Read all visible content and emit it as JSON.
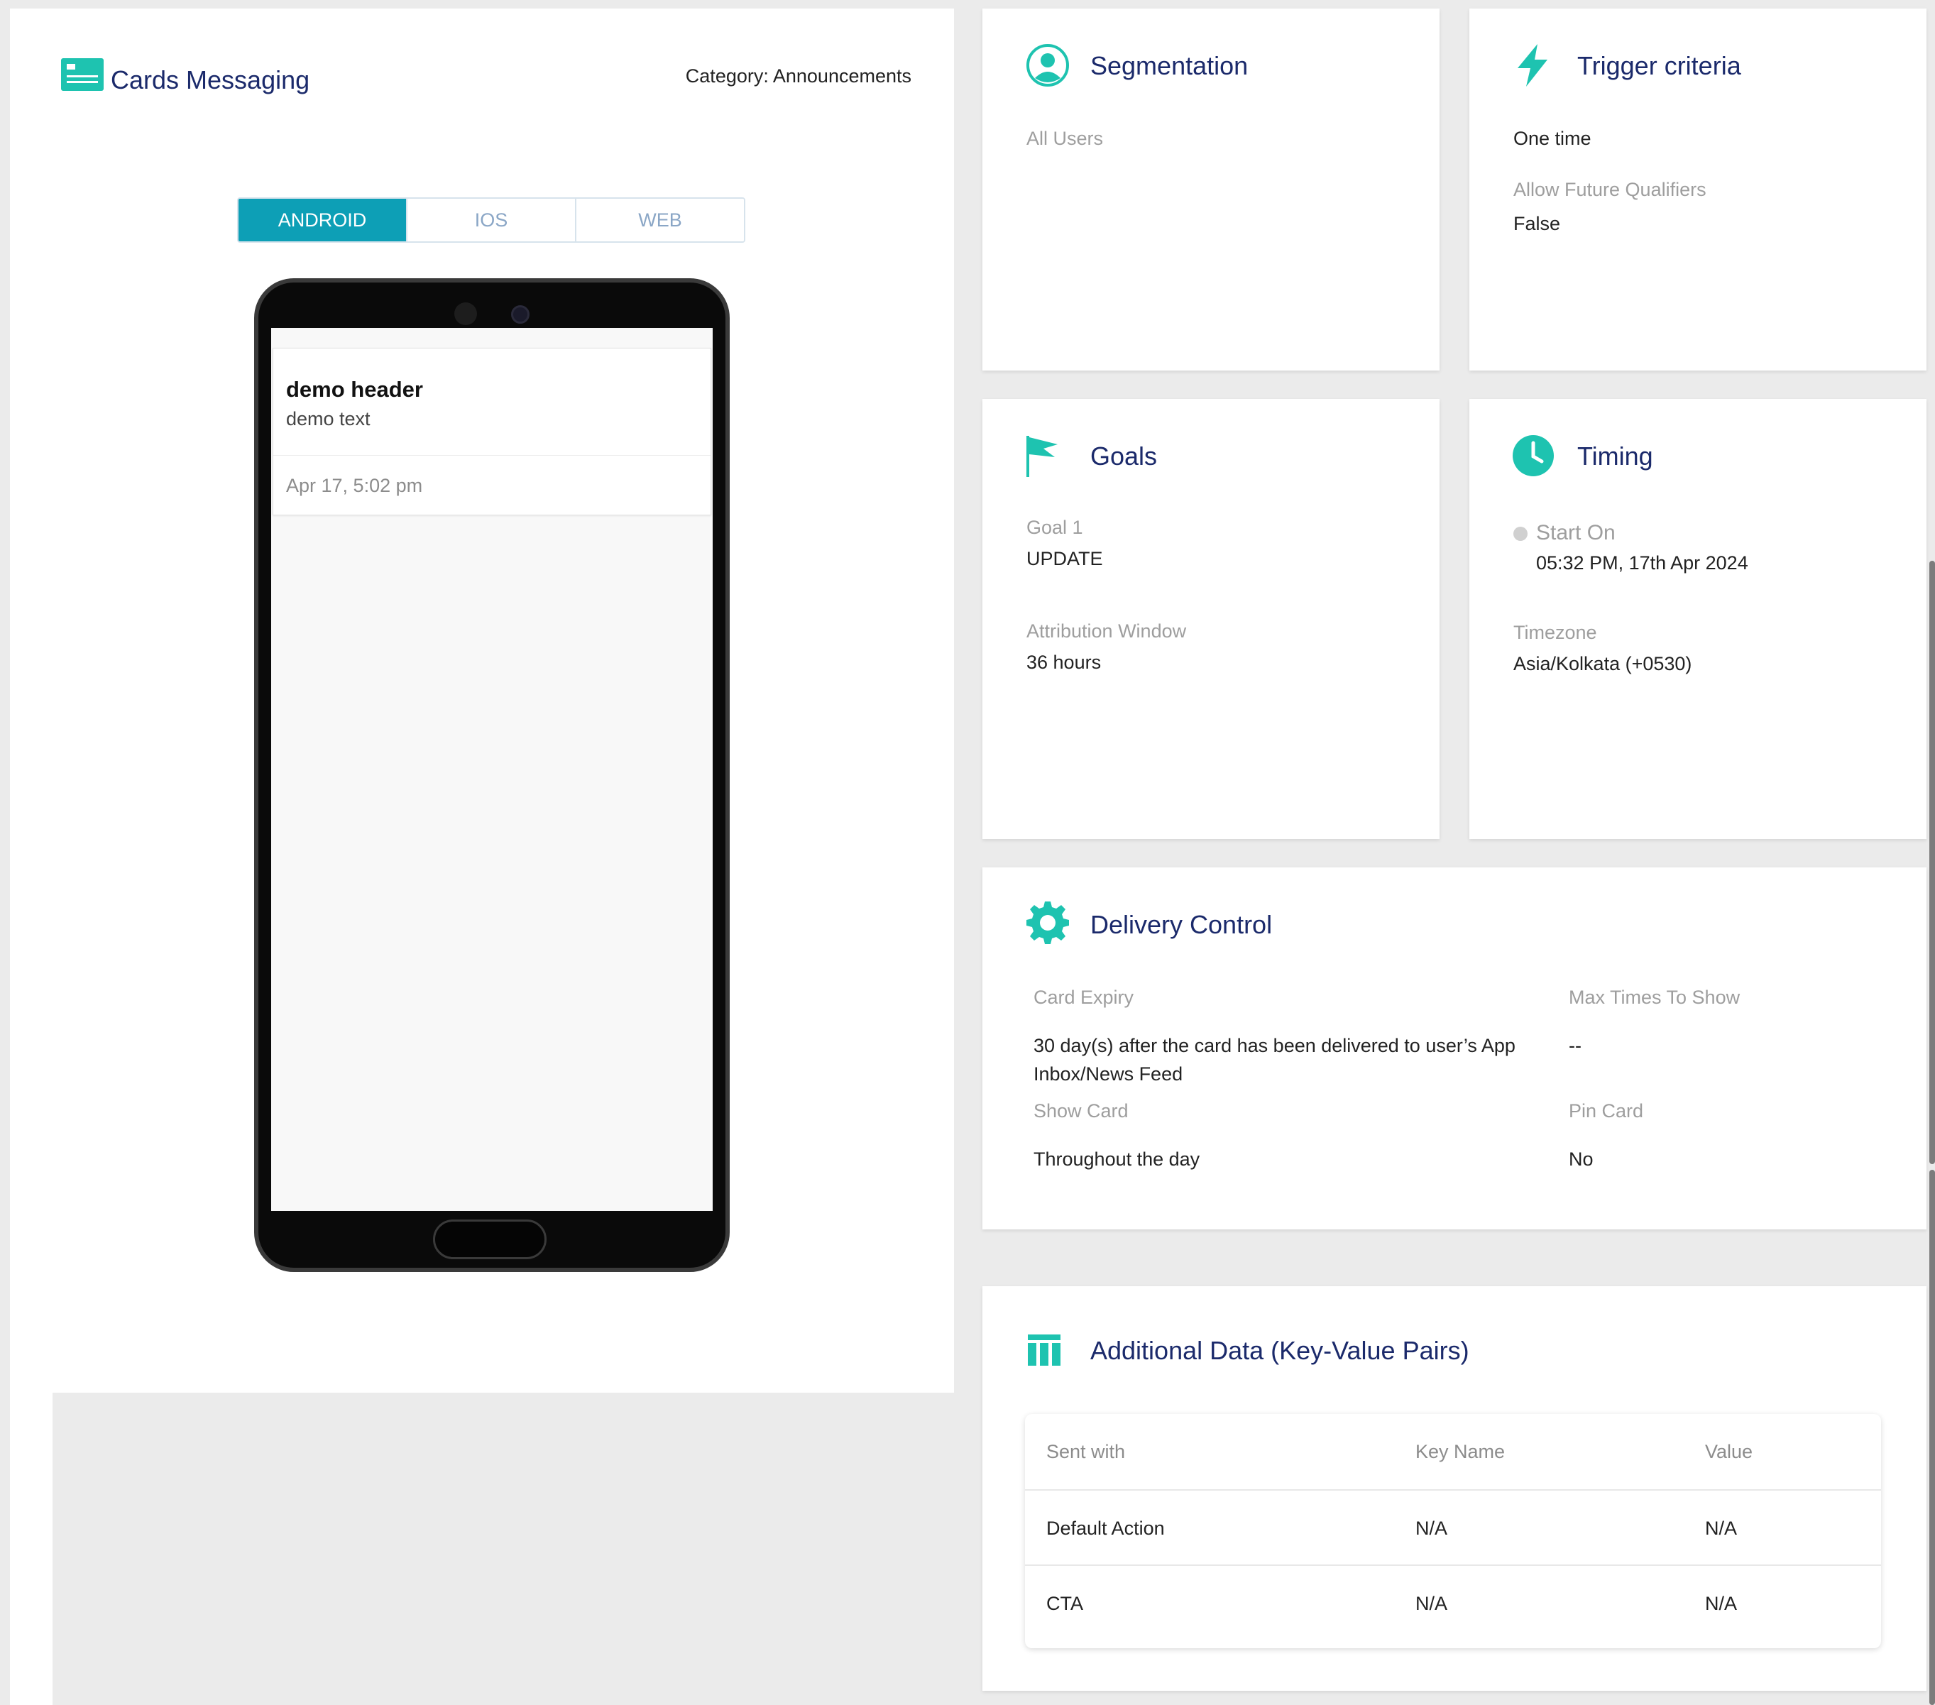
{
  "preview": {
    "title": "Cards Messaging",
    "category": "Category: Announcements",
    "tabs": [
      {
        "label": "ANDROID"
      },
      {
        "label": "IOS"
      },
      {
        "label": "WEB"
      }
    ],
    "card": {
      "header": "demo header",
      "text": "demo text",
      "time": "Apr 17, 5:02 pm"
    }
  },
  "segmentation": {
    "title": "Segmentation",
    "value": "All Users"
  },
  "trigger": {
    "title": "Trigger criteria",
    "value": "One time",
    "allow_label": "Allow Future Qualifiers",
    "allow_value": "False"
  },
  "goals": {
    "title": "Goals",
    "goal_label": "Goal 1",
    "goal_value": "UPDATE",
    "window_label": "Attribution Window",
    "window_value": "36 hours"
  },
  "timing": {
    "title": "Timing",
    "start_label": "Start On",
    "start_value": "05:32 PM, 17th Apr 2024",
    "tz_label": "Timezone",
    "tz_value": "Asia/Kolkata (+0530)"
  },
  "delivery": {
    "title": "Delivery Control",
    "expiry_label": "Card Expiry",
    "expiry_line1": "30 day(s) after the card has been delivered to user’s App",
    "expiry_line2": "Inbox/News Feed",
    "max_label": "Max Times To Show",
    "max_value": "--",
    "show_label": "Show Card",
    "show_value": "Throughout the day",
    "pin_label": "Pin Card",
    "pin_value": "No"
  },
  "additional": {
    "title": "Additional Data (Key-Value Pairs)",
    "headers": [
      "Sent with",
      "Key Name",
      "Value"
    ],
    "rows": [
      [
        "Default Action",
        "N/A",
        "N/A"
      ],
      [
        "CTA",
        "N/A",
        "N/A"
      ]
    ]
  },
  "colors": {
    "accent": "#1ec3b0",
    "tab_active": "#0d9fb6",
    "title": "#1b2a6b"
  }
}
